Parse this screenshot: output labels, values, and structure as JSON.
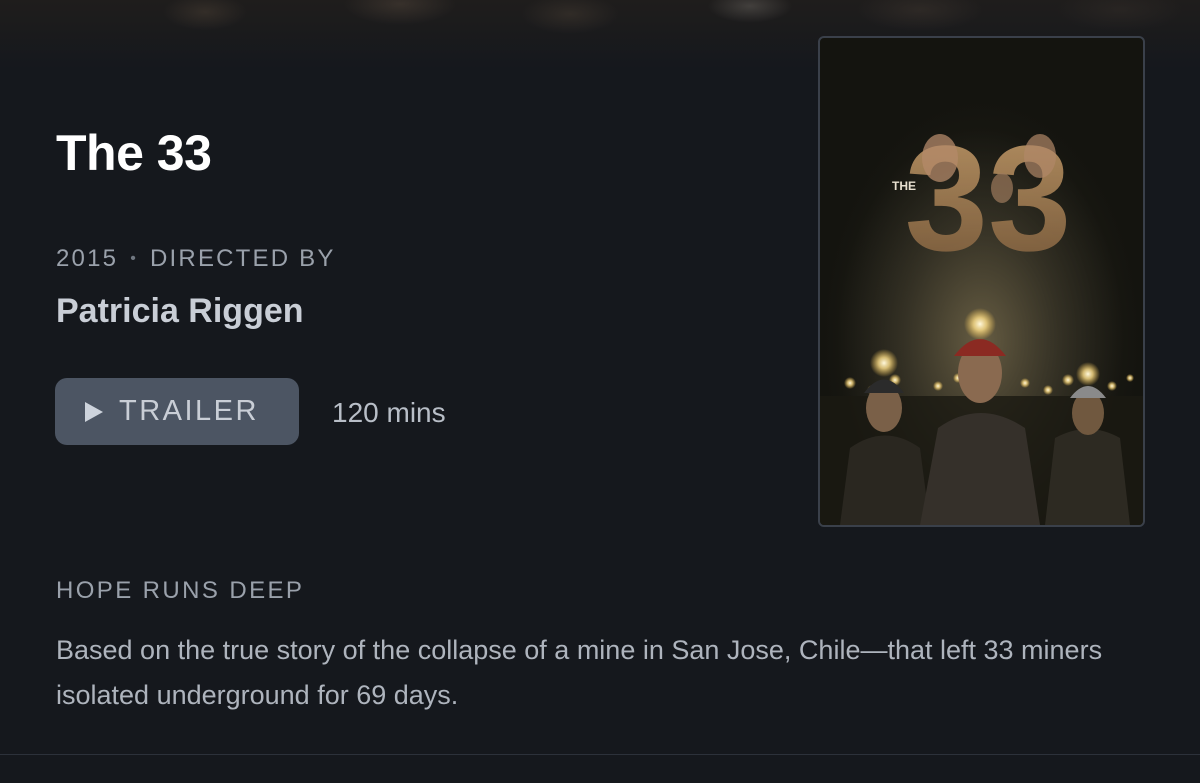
{
  "movie": {
    "title": "The 33",
    "year": "2015",
    "directed_by_label": "DIRECTED BY",
    "director": "Patricia Riggen",
    "trailer_label": "TRAILER",
    "runtime": "120 mins",
    "tagline": "HOPE RUNS DEEP",
    "synopsis": "Based on the true story of the collapse of a mine in San Jose, Chile—that left 33 miners isolated underground for 69 days."
  },
  "poster": {
    "title_small": "THE",
    "title_big": "33"
  },
  "icons": {
    "play": "play-icon"
  },
  "colors": {
    "background": "#15181d",
    "button": "#4c5563",
    "text_primary": "#ffffff",
    "text_muted": "#9aa1ab"
  }
}
